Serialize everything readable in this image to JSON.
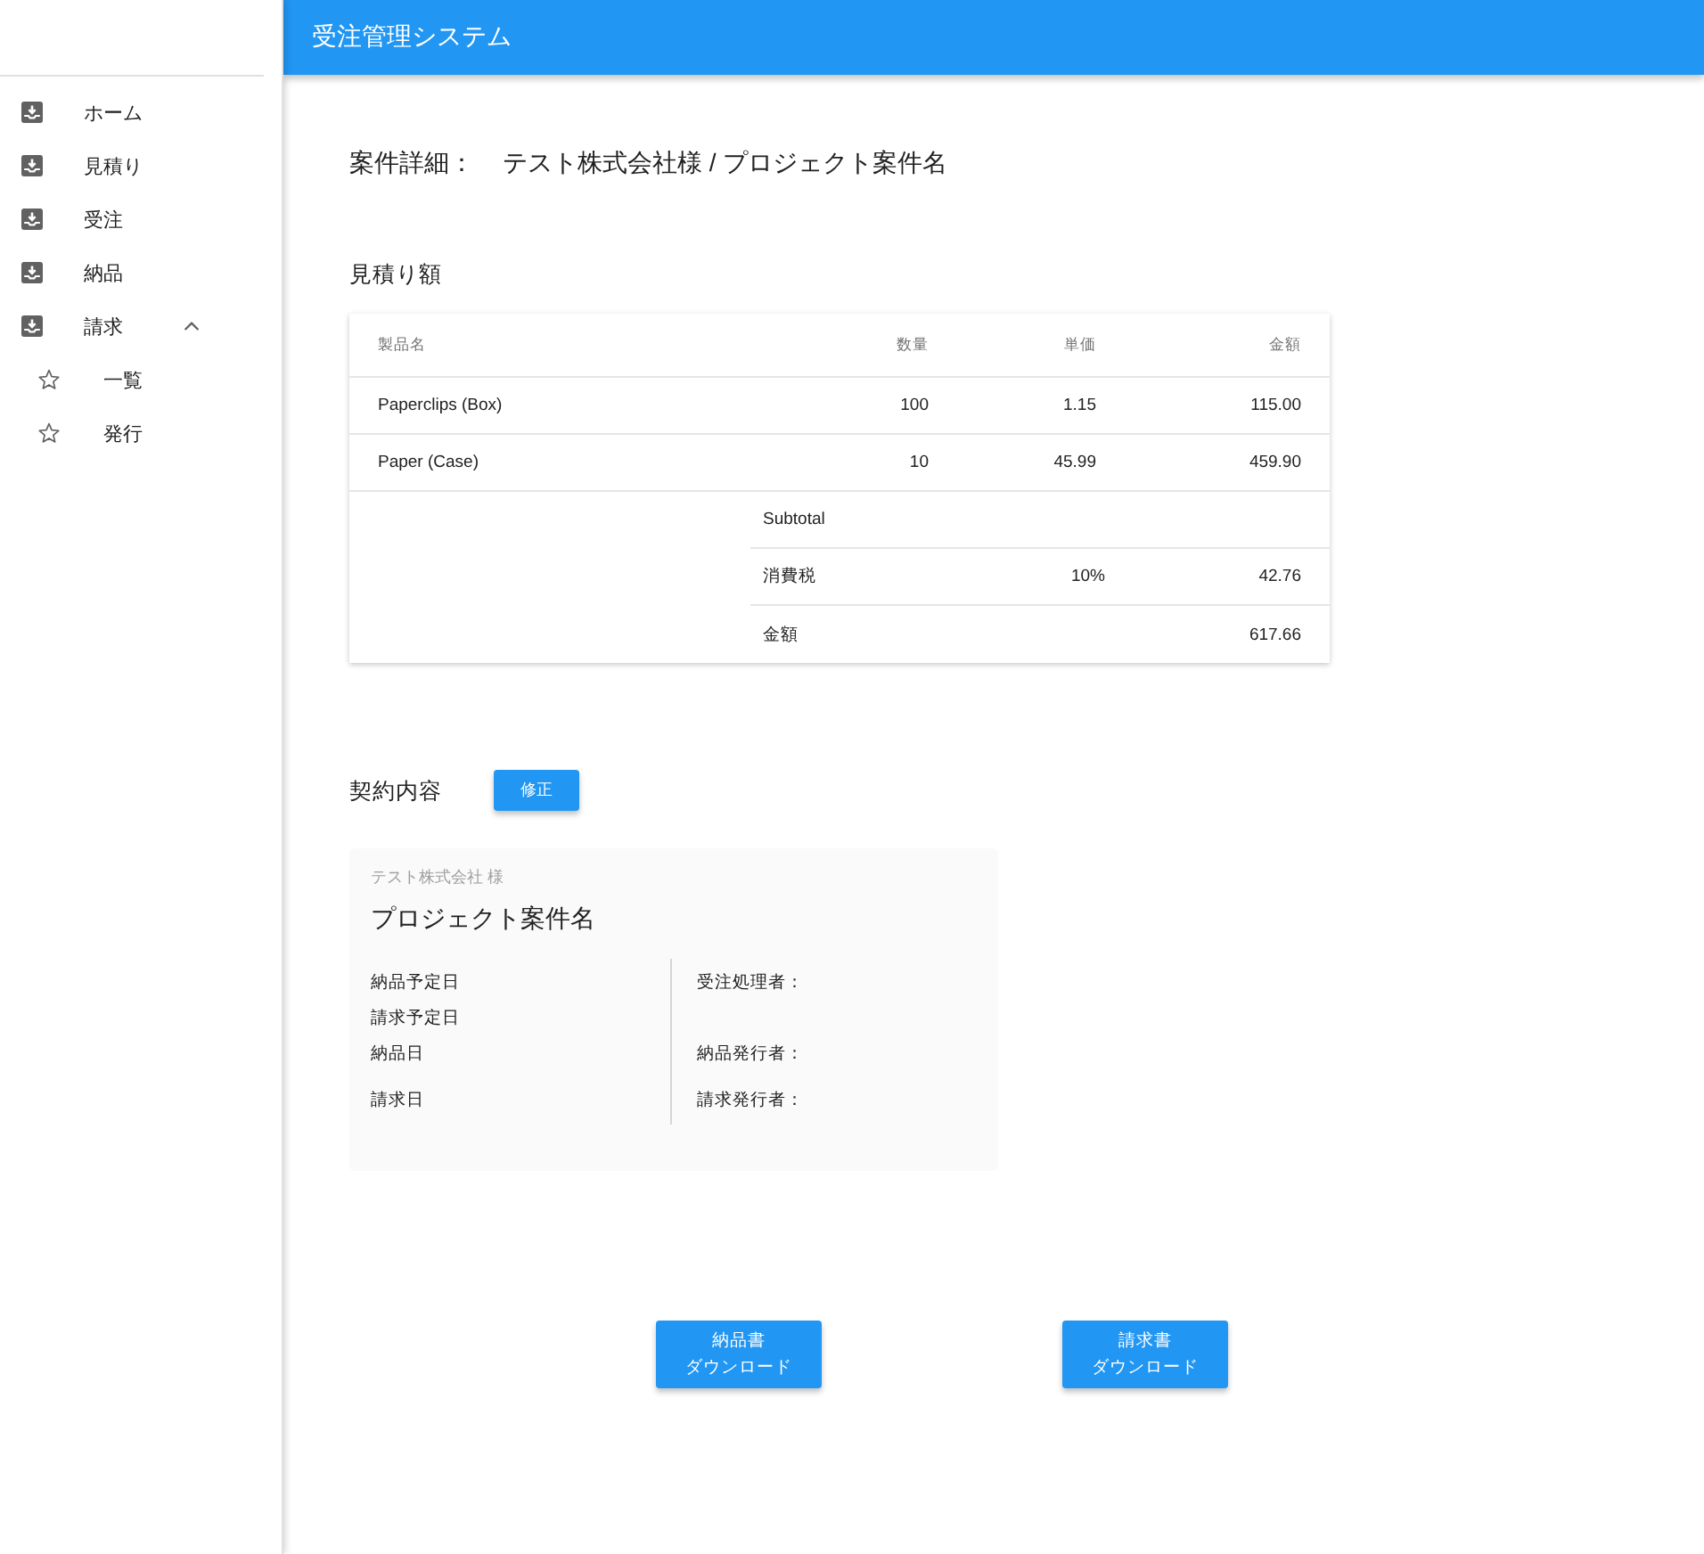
{
  "header": {
    "title": "受注管理システム"
  },
  "sidebar": {
    "items": [
      {
        "label": "ホーム",
        "selected": false
      },
      {
        "label": "見積り",
        "selected": false
      },
      {
        "label": "受注",
        "selected": false
      },
      {
        "label": "納品",
        "selected": false
      },
      {
        "label": "請求",
        "selected": false,
        "expanded": true,
        "children": [
          {
            "label": "一覧",
            "selected": false
          },
          {
            "label": "発行",
            "selected": false
          }
        ]
      }
    ]
  },
  "case_heading": {
    "label": "案件詳細：",
    "value": "テスト株式会社様 / プロジェクト案件名"
  },
  "estimate": {
    "title": "見積り額",
    "table": {
      "columns": [
        "製品名",
        "数量",
        "単価",
        "金額"
      ],
      "rows": [
        [
          "Paperclips (Box)",
          "100",
          "1.15",
          "115.00"
        ],
        [
          "Paper (Case)",
          "10",
          "45.99",
          "459.90"
        ]
      ],
      "summary": [
        {
          "label": "Subtotal"
        },
        {
          "label": "消費税",
          "rate": "10%",
          "amount": "42.76"
        },
        {
          "label": "金額",
          "amount": "617.66"
        }
      ]
    }
  },
  "contract": {
    "title": "契約内容",
    "edit_button": "修正",
    "client": "テスト株式会社 様",
    "project": "プロジェクト案件名",
    "rows": [
      {
        "left": "納品予定日",
        "right": "受注処理者："
      },
      {
        "left": "請求予定日"
      },
      {
        "left": "納品日",
        "right": "納品発行者："
      },
      {
        "left": "請求日",
        "right": "請求発行者："
      }
    ]
  },
  "download_buttons": [
    {
      "label_lines": [
        "納品書",
        "ダウンロード"
      ]
    },
    {
      "label_lines": [
        "請求書",
        "ダウンロード"
      ]
    }
  ]
}
